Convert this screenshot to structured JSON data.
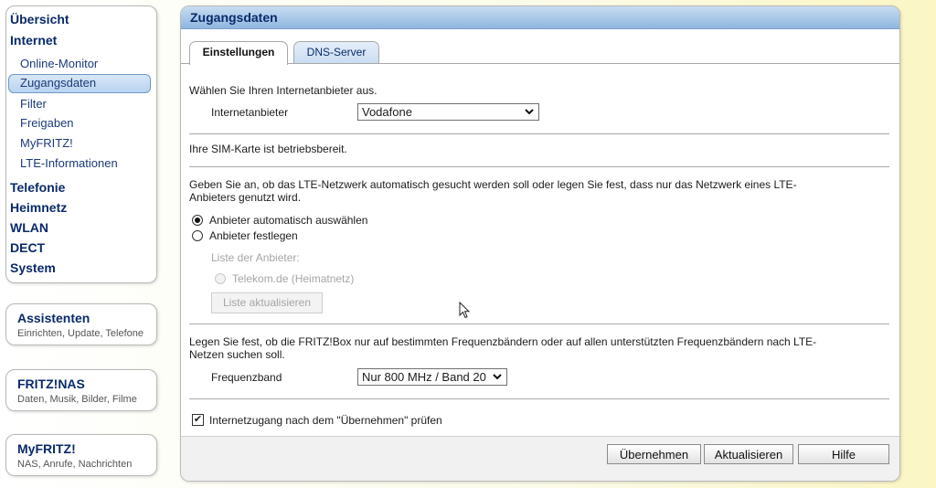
{
  "nav": {
    "main": [
      "Übersicht",
      "Internet",
      "Telefonie",
      "Heimnetz",
      "WLAN",
      "DECT",
      "System"
    ],
    "sub": [
      "Online-Monitor",
      "Zugangsdaten",
      "Filter",
      "Freigaben",
      "MyFRITZ!",
      "LTE-Informationen"
    ]
  },
  "side": [
    {
      "title": "Assistenten",
      "sub": "Einrichten, Update, Telefone"
    },
    {
      "title": "FRITZ!NAS",
      "sub": "Daten, Musik, Bilder, Filme"
    },
    {
      "title": "MyFRITZ!",
      "sub": "NAS, Anrufe, Nachrichten"
    }
  ],
  "panel": {
    "title": "Zugangsdaten",
    "tabs": [
      "Einstellungen",
      "DNS-Server"
    ]
  },
  "form": {
    "provider_intro": "Wählen Sie Ihren Internetanbieter aus.",
    "provider_label": "Internetanbieter",
    "provider_value": "Vodafone",
    "sim_status": "Ihre SIM-Karte ist betriebsbereit.",
    "network_intro_1": "Geben Sie an, ob das LTE-Netzwerk automatisch gesucht werden soll oder legen Sie fest, dass nur das Netzwerk eines LTE-",
    "network_intro_2": "Anbieters genutzt wird.",
    "radio_auto": "Anbieter automatisch auswählen",
    "radio_fixed": "Anbieter festlegen",
    "list_label": "Liste der Anbieter:",
    "list_item": "Telekom.de (Heimatnetz)",
    "refresh_list": "Liste aktualisieren",
    "freq_intro_1": "Legen Sie fest, ob die FRITZ!Box nur auf bestimmten Frequenzbändern oder auf allen unterstützten Frequenzbändern nach LTE-",
    "freq_intro_2": "Netzen suchen soll.",
    "freq_label": "Frequenzband",
    "freq_value": "Nur 800 MHz / Band 20",
    "check_label": "Internetzugang nach dem \"Übernehmen\" prüfen",
    "check_mark": "✔"
  },
  "buttons": {
    "apply": "Übernehmen",
    "refresh": "Aktualisieren",
    "help": "Hilfe"
  },
  "icons": {
    "dropdown": "chevron-down-icon",
    "cursor": "mouse-pointer-icon"
  }
}
